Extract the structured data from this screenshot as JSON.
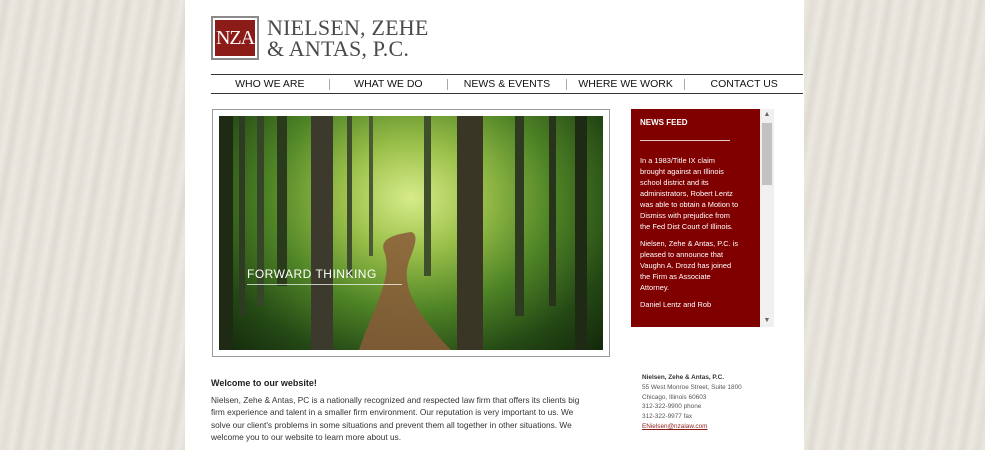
{
  "logo": {
    "monogram": "NZA",
    "line1": "NIELSEN, ZEHE",
    "line2": "& ANTAS, P.C."
  },
  "nav": [
    {
      "label": "WHO WE ARE"
    },
    {
      "label": "WHAT WE DO"
    },
    {
      "label": "NEWS & EVENTS"
    },
    {
      "label": "WHERE WE WORK"
    },
    {
      "label": "CONTACT US"
    }
  ],
  "hero": {
    "caption": "FORWARD THINKING"
  },
  "news": {
    "title": "NEWS FEED",
    "items": [
      "In a 1983/Title IX claim brought against an Illinois school district and its administrators, Robert Lentz was able to obtain a Motion to Dismiss with prejudice from the Fed Dist Court of Illinois.",
      "Nielsen, Zehe & Antas, P.C. is pleased to announce that Vaughn A. Drozd has joined the Firm as Associate Attorney.",
      "Daniel Lentz and Rob"
    ]
  },
  "welcome": {
    "title": "Welcome to our website!",
    "text": "Nielsen, Zehe & Antas, PC is a nationally recognized and respected law firm that offers its clients big firm experience and talent in a smaller firm environment. Our reputation is very important to us. We solve our client's problems in some situations and prevent them all together in other situations. We welcome you to our website to learn more about us."
  },
  "contact": {
    "name": "Nielsen, Zehe & Antas, P.C.",
    "address": "55 West Monroe Street, Suite 1800",
    "city": "Chicago, Illinois 60603",
    "phone": "312-322-9900 phone",
    "fax": "312-322-9977 fax",
    "email": "ENielsen@nzalaw.com"
  },
  "colors": {
    "brand_red": "#800000",
    "logo_red": "#8c1c18"
  },
  "icons": {
    "scroll_up": "scroll-up-arrow-icon",
    "scroll_down": "scroll-down-arrow-icon"
  }
}
